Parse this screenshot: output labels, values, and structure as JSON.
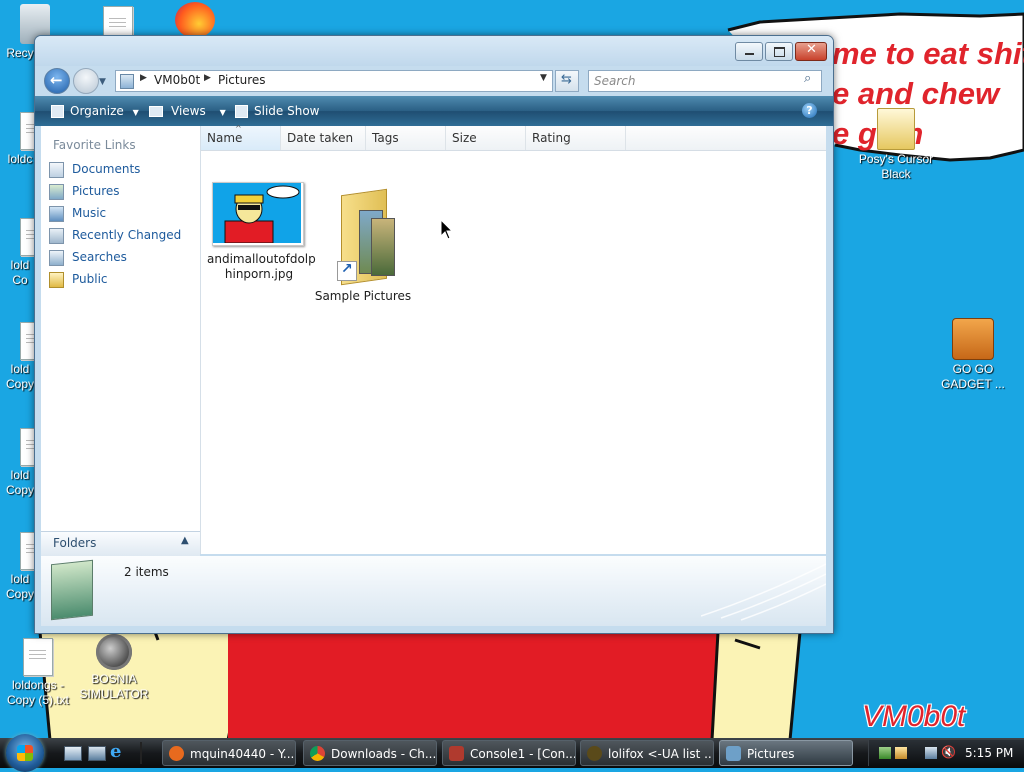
{
  "desktop": {
    "wallpaper_text_1": "me to eat shit",
    "wallpaper_text_2": "e and chew",
    "wallpaper_text_3": "e gum",
    "wallpaper_logo": "VM0b0t",
    "icons": [
      {
        "label": "Recy"
      },
      {
        "label": "loldc"
      },
      {
        "label": "lold",
        "label2": "Co"
      },
      {
        "label": "lold",
        "label2": "Copy"
      },
      {
        "label": "lold",
        "label2": "Copy"
      },
      {
        "label": "lold",
        "label2": "Copy"
      },
      {
        "label": "loldongs -",
        "label2": "Copy (5).txt"
      },
      {
        "label": "BOSNIA",
        "label2": "SIMULATOR"
      },
      {
        "label": "Posy's Cursor",
        "label2": "Black"
      },
      {
        "label": "GO GO",
        "label2": "GADGET ..."
      }
    ]
  },
  "window": {
    "breadcrumb": [
      "VM0b0t",
      "Pictures"
    ],
    "search_placeholder": "Search",
    "toolbar": {
      "organize": "Organize",
      "views": "Views",
      "slideshow": "Slide Show"
    },
    "favorites_title": "Favorite Links",
    "favorites": [
      {
        "label": "Documents",
        "icon": "documents-icon"
      },
      {
        "label": "Pictures",
        "icon": "pictures-icon"
      },
      {
        "label": "Music",
        "icon": "music-icon"
      },
      {
        "label": "Recently Changed",
        "icon": "recent-icon"
      },
      {
        "label": "Searches",
        "icon": "searches-icon"
      },
      {
        "label": "Public",
        "icon": "public-folder-icon"
      }
    ],
    "folders_label": "Folders",
    "columns": [
      "Name",
      "Date taken",
      "Tags",
      "Size",
      "Rating"
    ],
    "files": [
      {
        "name_line1": "andimalloutofdolp",
        "name_line2": "hinporn.jpg",
        "type": "image"
      },
      {
        "name_line1": "Sample Pictures",
        "name_line2": "",
        "type": "folder-shortcut"
      }
    ],
    "item_count": "2 items"
  },
  "taskbar": {
    "buttons": [
      {
        "label": "mquin40440 - Y...",
        "icon": "firefox-icon",
        "color": "#e86a1e"
      },
      {
        "label": "Downloads - Ch...",
        "icon": "chrome-icon",
        "color": "#3b7be0"
      },
      {
        "label": "Console1 - [Con...",
        "icon": "mmc-console-icon",
        "color": "#b03a2e"
      },
      {
        "label": "lolifox <-UA list ...",
        "icon": "lolifox-icon",
        "color": "#5a4a1a"
      },
      {
        "label": "Pictures",
        "icon": "explorer-icon",
        "color": "#6ea0c8"
      }
    ],
    "clock": "5:15 PM"
  }
}
